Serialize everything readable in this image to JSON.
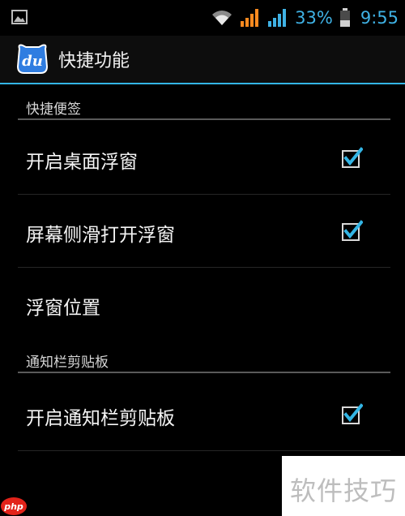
{
  "status_bar": {
    "battery": "33%",
    "time": "9:55",
    "icons": [
      "image-icon",
      "wifi-icon",
      "signal-icon",
      "signal-icon",
      "battery-icon"
    ]
  },
  "action_bar": {
    "app_icon_text": "du",
    "title": "快捷功能"
  },
  "sections": [
    {
      "title": "快捷便签",
      "items": [
        {
          "label": "开启桌面浮窗",
          "checked": true
        },
        {
          "label": "屏幕侧滑打开浮窗",
          "checked": true
        },
        {
          "label": "浮窗位置",
          "checked": null
        }
      ]
    },
    {
      "title": "通知栏剪贴板",
      "items": [
        {
          "label": "开启通知栏剪贴板",
          "checked": true
        }
      ]
    }
  ],
  "watermark": {
    "text": "软件技巧",
    "badge": "php"
  },
  "colors": {
    "accent": "#33b5e5",
    "check": "#33b5e5",
    "background": "#000000"
  }
}
